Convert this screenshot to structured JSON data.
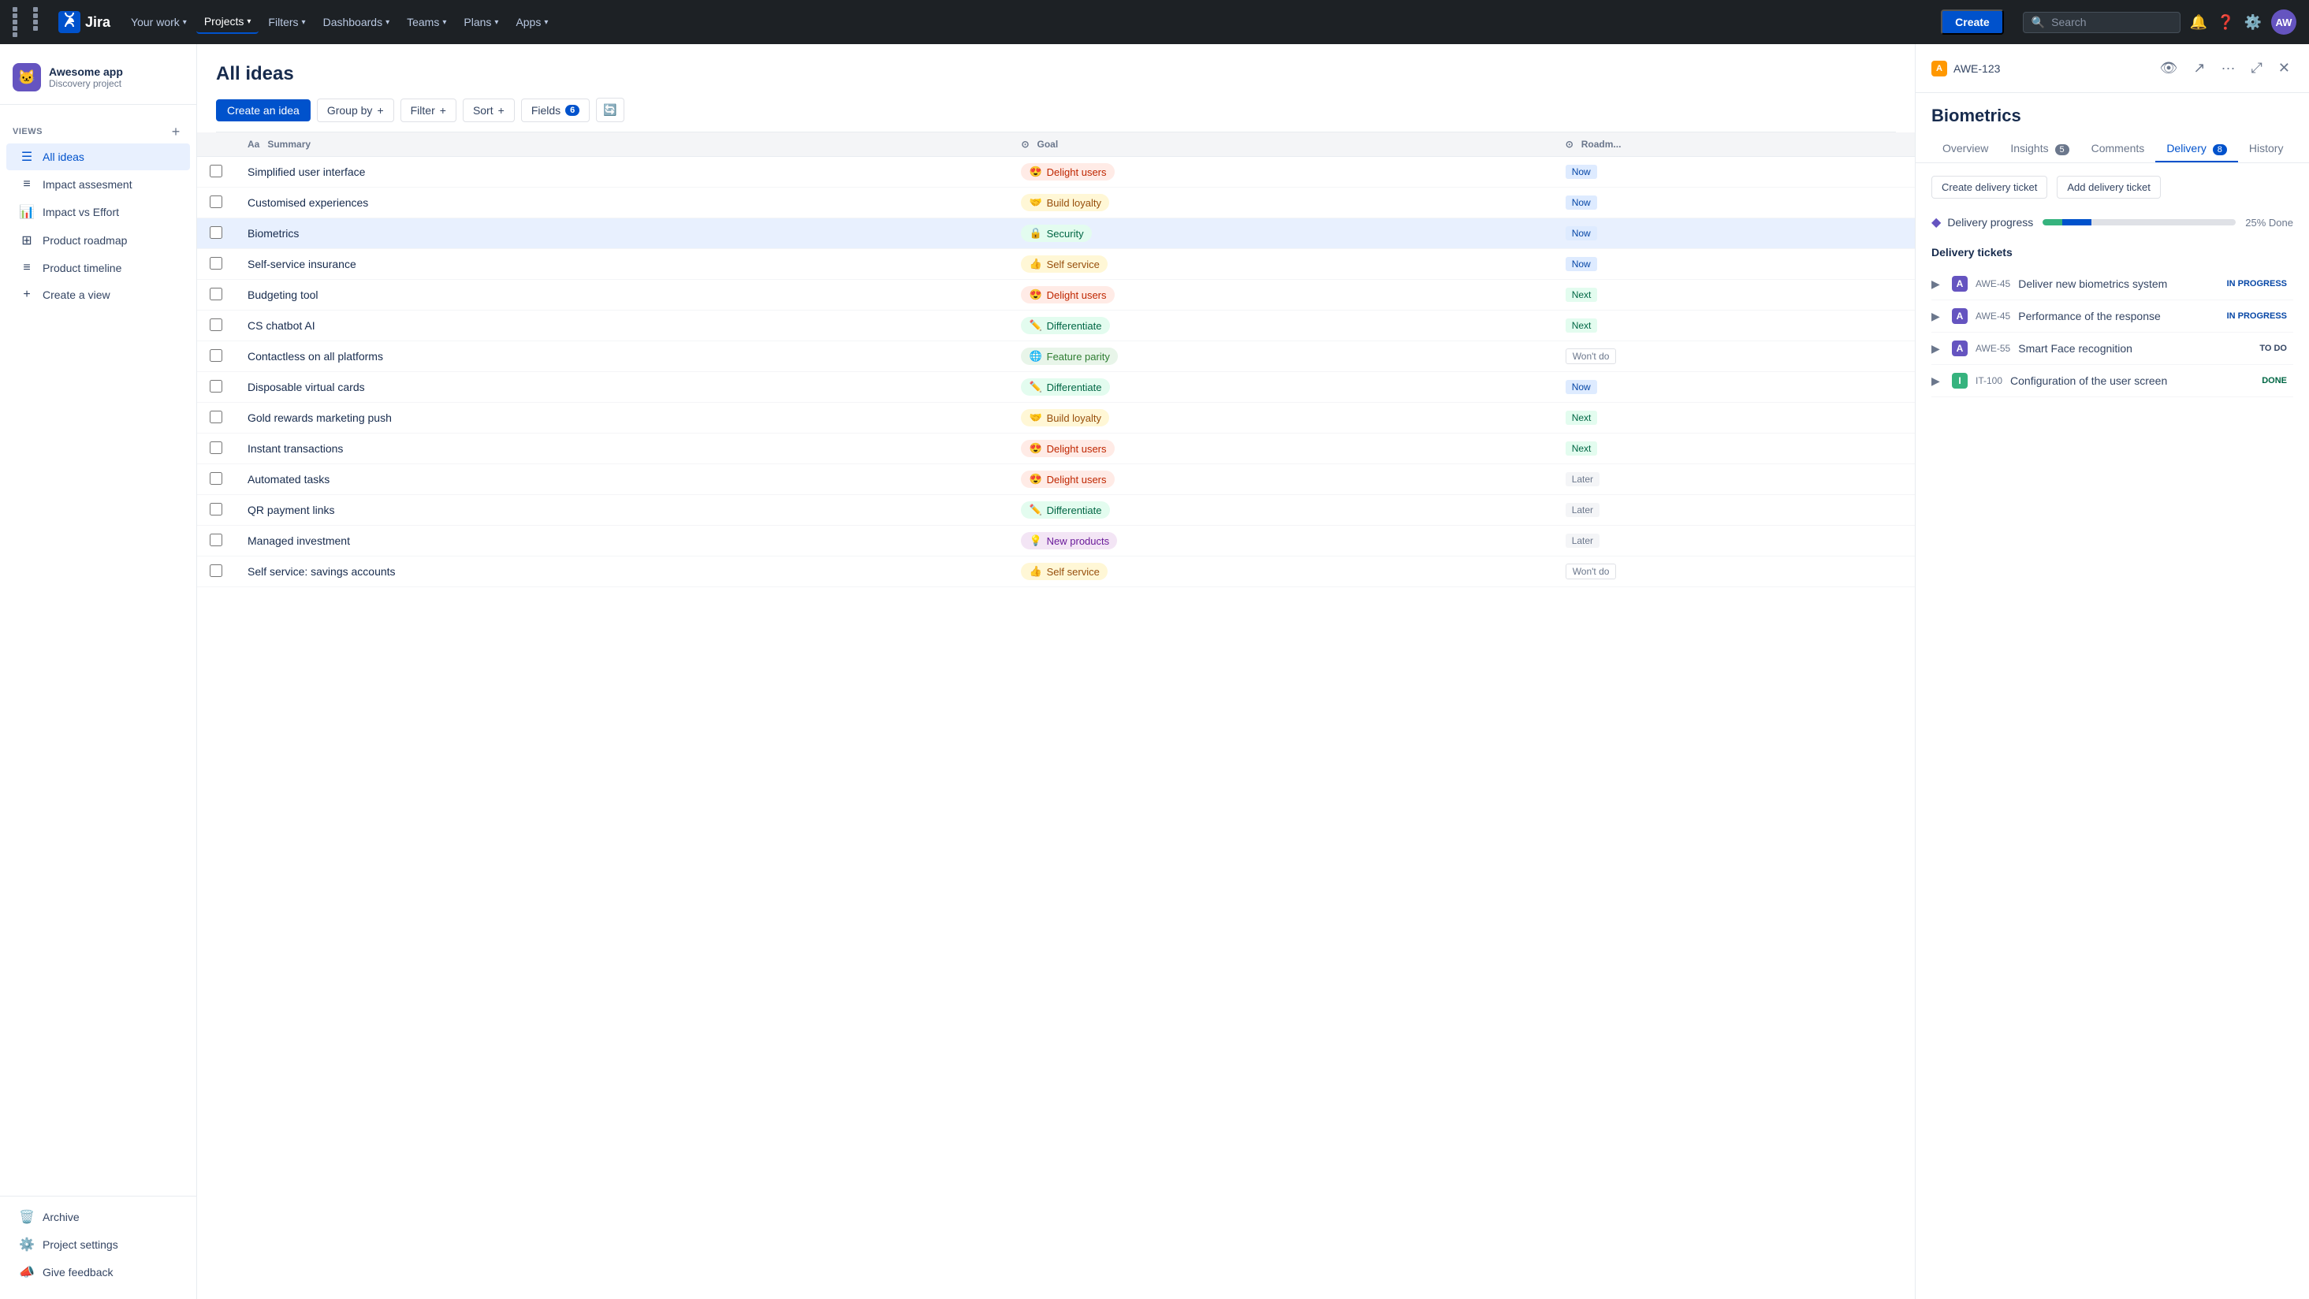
{
  "topnav": {
    "logo_text": "Jira",
    "nav_items": [
      {
        "label": "Your work",
        "has_chevron": true
      },
      {
        "label": "Projects",
        "has_chevron": true
      },
      {
        "label": "Filters",
        "has_chevron": true
      },
      {
        "label": "Dashboards",
        "has_chevron": true
      },
      {
        "label": "Teams",
        "has_chevron": true
      },
      {
        "label": "Plans",
        "has_chevron": true
      },
      {
        "label": "Apps",
        "has_chevron": true
      }
    ],
    "create_label": "Create",
    "search_placeholder": "Search",
    "avatar_initials": "AW"
  },
  "sidebar": {
    "project_name": "Awesome app",
    "project_type": "Discovery project",
    "project_emoji": "🐱",
    "views_label": "VIEWS",
    "nav_items": [
      {
        "label": "All ideas",
        "icon": "☰",
        "active": true
      },
      {
        "label": "Impact assesment",
        "icon": "≡"
      },
      {
        "label": "Impact vs Effort",
        "icon": "📈"
      },
      {
        "label": "Product roadmap",
        "icon": "⊞"
      },
      {
        "label": "Product timeline",
        "icon": "≡"
      }
    ],
    "create_view_label": "Create a view",
    "archive_label": "Archive",
    "project_settings_label": "Project settings",
    "feedback_label": "Give feedback"
  },
  "main": {
    "title": "All ideas",
    "toolbar": {
      "create_idea": "Create an idea",
      "group_by": "Group by",
      "filter": "Filter",
      "sort": "Sort",
      "fields": "Fields",
      "fields_count": "6"
    },
    "table": {
      "columns": [
        "",
        "Aa  Summary",
        "⊙  Goal",
        "⊙  Roadm..."
      ],
      "rows": [
        {
          "summary": "Simplified user interface",
          "goal": "Delight users",
          "goal_type": "delight",
          "goal_emoji": "😍",
          "roadmap": "Now",
          "roadmap_type": "now"
        },
        {
          "summary": "Customised experiences",
          "goal": "Build loyalty",
          "goal_type": "loyalty",
          "goal_emoji": "🤝",
          "roadmap": "Now",
          "roadmap_type": "now"
        },
        {
          "summary": "Biometrics",
          "goal": "Security",
          "goal_type": "security",
          "goal_emoji": "🔒",
          "roadmap": "Now",
          "roadmap_type": "now",
          "active": true
        },
        {
          "summary": "Self-service insurance",
          "goal": "Self service",
          "goal_type": "service",
          "goal_emoji": "👍",
          "roadmap": "Now",
          "roadmap_type": "now"
        },
        {
          "summary": "Budgeting tool",
          "goal": "Delight users",
          "goal_type": "delight",
          "goal_emoji": "😍",
          "roadmap": "Next",
          "roadmap_type": "next"
        },
        {
          "summary": "CS chatbot AI",
          "goal": "Differentiate",
          "goal_type": "differentiate",
          "goal_emoji": "✏️",
          "roadmap": "Next",
          "roadmap_type": "next"
        },
        {
          "summary": "Contactless on all platforms",
          "goal": "Feature parity",
          "goal_type": "parity",
          "goal_emoji": "🌐",
          "roadmap": "Won't do",
          "roadmap_type": "wontdo"
        },
        {
          "summary": "Disposable virtual cards",
          "goal": "Differentiate",
          "goal_type": "differentiate",
          "goal_emoji": "✏️",
          "roadmap": "Now",
          "roadmap_type": "now"
        },
        {
          "summary": "Gold rewards marketing push",
          "goal": "Build loyalty",
          "goal_type": "loyalty",
          "goal_emoji": "🤝",
          "roadmap": "Next",
          "roadmap_type": "next"
        },
        {
          "summary": "Instant transactions",
          "goal": "Delight users",
          "goal_type": "delight",
          "goal_emoji": "😍",
          "roadmap": "Next",
          "roadmap_type": "next"
        },
        {
          "summary": "Automated tasks",
          "goal": "Delight users",
          "goal_type": "delight",
          "goal_emoji": "😍",
          "roadmap": "Later",
          "roadmap_type": "later"
        },
        {
          "summary": "QR payment links",
          "goal": "Differentiate",
          "goal_type": "differentiate",
          "goal_emoji": "✏️",
          "roadmap": "Later",
          "roadmap_type": "later"
        },
        {
          "summary": "Managed investment",
          "goal": "New products",
          "goal_type": "newproducts",
          "goal_emoji": "💡",
          "roadmap": "Later",
          "roadmap_type": "later"
        },
        {
          "summary": "Self service: savings accounts",
          "goal": "Self service",
          "goal_type": "service",
          "goal_emoji": "👍",
          "roadmap": "Won't do",
          "roadmap_type": "wontdo"
        }
      ]
    }
  },
  "panel": {
    "issue_id": "AWE-123",
    "issue_icon": "A",
    "title": "Biometrics",
    "tabs": [
      {
        "label": "Overview",
        "active": false
      },
      {
        "label": "Insights",
        "count": "5",
        "active": false
      },
      {
        "label": "Comments",
        "active": false
      },
      {
        "label": "Delivery",
        "count": "8",
        "active": true
      },
      {
        "label": "History",
        "active": false
      }
    ],
    "delivery": {
      "create_ticket_label": "Create delivery ticket",
      "add_ticket_label": "Add delivery ticket",
      "progress_label": "Delivery progress",
      "progress_percent": "25% Done",
      "progress_value": 25,
      "tickets_label": "Delivery tickets",
      "tickets": [
        {
          "expand": true,
          "type": "purple",
          "type_label": "A",
          "id": "AWE-45",
          "title": "Deliver new biometrics system",
          "status": "IN PROGRESS",
          "status_type": "inprogress"
        },
        {
          "expand": true,
          "type": "purple",
          "type_label": "A",
          "id": "AWE-45",
          "title": "Performance of the response",
          "status": "IN PROGRESS",
          "status_type": "inprogress"
        },
        {
          "expand": true,
          "type": "purple",
          "type_label": "A",
          "id": "AWE-55",
          "title": "Smart Face recognition",
          "status": "TO DO",
          "status_type": "todo"
        },
        {
          "expand": true,
          "type": "green",
          "type_label": "I",
          "id": "IT-100",
          "title": "Configuration of the user screen",
          "status": "DONE",
          "status_type": "done"
        }
      ]
    }
  }
}
